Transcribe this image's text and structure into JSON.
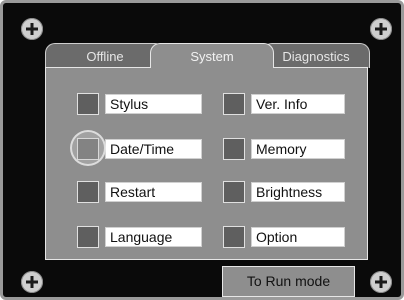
{
  "tabs": [
    {
      "label": "Offline"
    },
    {
      "label": "System",
      "active": true
    },
    {
      "label": "Diagnostics"
    }
  ],
  "menu": {
    "left": [
      {
        "label": "Stylus"
      },
      {
        "label": "Date/Time"
      },
      {
        "label": "Restart"
      },
      {
        "label": "Language"
      }
    ],
    "right": [
      {
        "label": "Ver. Info"
      },
      {
        "label": "Memory"
      },
      {
        "label": "Brightness"
      },
      {
        "label": "Option"
      }
    ]
  },
  "run_button": {
    "label": "To Run mode"
  },
  "colors": {
    "bezel": "#0a0a0a",
    "panel": "#8e8e8e",
    "checkbox": "#5f5f5f",
    "label_bg": "#ffffff"
  },
  "icons": {
    "corner_screw": "plus-screw-icon",
    "touch_indicator": "touch-ring-icon"
  }
}
